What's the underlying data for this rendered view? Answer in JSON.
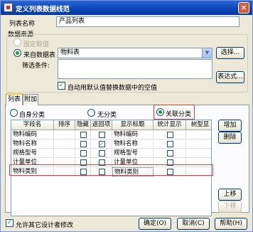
{
  "window": {
    "title": "定义列表数据线范"
  },
  "list_name": {
    "label": "列表名称",
    "value": "产品列表"
  },
  "data_source": {
    "label": "数据来源",
    "fixed_value_label": "固定取值",
    "from_table_label": "来自数据表",
    "table_value": "物料表",
    "select_button": "选择...",
    "filter_label": "筛选条件:",
    "filter_value": "",
    "expression_button": "表达式...",
    "auto_replace_label": "自动用默认值替换数据中的空值"
  },
  "tabs": [
    {
      "label": "列表"
    },
    {
      "label": "附加"
    }
  ],
  "classification": {
    "self": "自身分类",
    "none": "无分类",
    "related": "关联分类"
  },
  "grid": {
    "headers": [
      "字段名",
      "排序",
      "隐藏",
      "返回项",
      "显示标题",
      "统计显示",
      "树型显"
    ],
    "rows": [
      {
        "field": "物料编码",
        "sort": "",
        "hidden": false,
        "returned": false,
        "title": "物料编码",
        "stat": false
      },
      {
        "field": "物料名称",
        "sort": "",
        "hidden": false,
        "returned": true,
        "title": "物料名称",
        "stat": false
      },
      {
        "field": "规格型号",
        "sort": "",
        "hidden": false,
        "returned": false,
        "title": "规格型号",
        "stat": false
      },
      {
        "field": "计量单位",
        "sort": "",
        "hidden": false,
        "returned": false,
        "title": "计量单位",
        "stat": false
      },
      {
        "field": "物料类别",
        "sort": "",
        "hidden": false,
        "returned": false,
        "title": "物料类别",
        "stat": false
      }
    ]
  },
  "side_buttons": {
    "add": "增加",
    "delete": "删除",
    "up": "上移",
    "down": "下移"
  },
  "allow_others_label": "允许其它设计者修改",
  "bottom_buttons": {
    "ok": "确定(O)",
    "cancel": "取消(C)",
    "help": "帮助(H)"
  }
}
